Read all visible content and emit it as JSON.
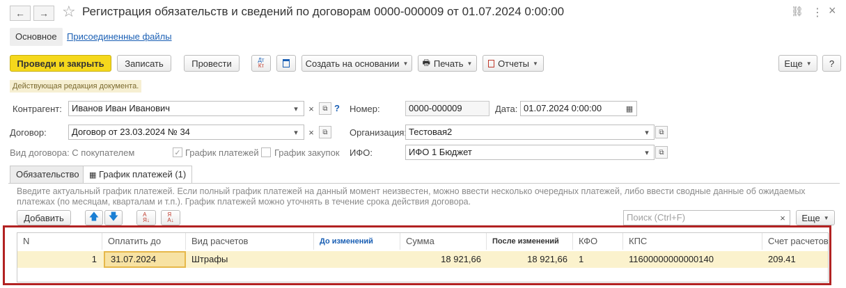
{
  "window": {
    "title": "Регистрация обязательств и сведений по договорам 0000-000009 от 01.07.2024 0:00:00",
    "nav_back": "←",
    "nav_forward": "→",
    "star": "☆",
    "link_icon": "🔗",
    "menu_icon": "⋮",
    "close_icon": "×"
  },
  "sections": {
    "main": "Основное",
    "attached": "Присоединенные файлы"
  },
  "toolbar": {
    "post_close": "Проведи и закрыть",
    "save": "Записать",
    "post": "Провести",
    "dt_kt": "Дт Кт",
    "create_based": "Создать на основании",
    "print": "Печать",
    "reports": "Отчеты",
    "more": "Еще",
    "help": "?"
  },
  "notice": "Действующая редакция документа.",
  "form": {
    "counterparty_label": "Контрагент:",
    "counterparty_value": "Иванов Иван Иванович",
    "number_label": "Номер:",
    "number_value": "0000-000009",
    "date_label": "Дата:",
    "date_value": "01.07.2024  0:00:00",
    "contract_label": "Договор:",
    "contract_value": "Договор от 23.03.2024 № 34",
    "org_label": "Организация:",
    "org_value": "Тестовая2",
    "contract_type": "Вид договора: С покупателем",
    "payment_schedule": "График платежей",
    "purchase_schedule": "График закупок",
    "ifo_label": "ИФО:",
    "ifo_value": "ИФО 1 Бюджет",
    "question": "?"
  },
  "tabs": {
    "obligation": "Обязательство",
    "schedule": "График платежей (1)"
  },
  "info_text": "Введите актуальный график платежей. Если полный график платежей на данный момент неизвестен, можно ввести несколько очередных платежей, либо ввести сводные данные об ожидаемых платежах (по месяцам, кварталам и т.п.). График платежей можно уточнять в течение срока действия договора.",
  "table_toolbar": {
    "add": "Добавить",
    "search_placeholder": "Поиск (Ctrl+F)",
    "more": "Еще"
  },
  "table": {
    "headers": [
      "N",
      "Оплатить до",
      "Вид расчетов",
      "До изменений",
      "Сумма",
      "После изменений",
      "КФО",
      "КПС",
      "Счет расчетов"
    ],
    "rows": [
      [
        "1",
        "31.07.2024",
        "Штрафы",
        "",
        "18 921,66",
        "18 921,66",
        "1",
        "11600000000000140",
        "209.41"
      ]
    ]
  },
  "colors": {
    "accent": "#f5d81c",
    "highlight_frame": "#b22222",
    "row_selected": "#fbf2cd",
    "link": "#1a5fb4"
  }
}
